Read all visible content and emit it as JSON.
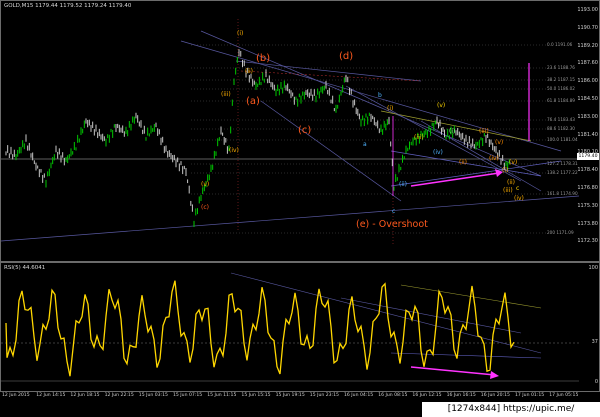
{
  "chart": {
    "title": "GOLD,M15  1179.44 1179.52 1179.24 1179.40",
    "rsi_title": "RSI(5) 44.6041",
    "price_ticks": [
      "1193.00",
      "1190.70",
      "1189.20",
      "1187.60",
      "1186.00",
      "1184.50",
      "1183.00",
      "1181.40",
      "1180.10",
      "1178.40",
      "1176.80",
      "1175.30",
      "1173.80",
      "1172.30"
    ],
    "current_price": "1179.40",
    "rsi_ticks": [
      "100",
      "37",
      "0"
    ],
    "time_ticks": [
      "12 Jun 2015",
      "12 Jun 14:15",
      "12 Jun 18:15",
      "12 Jun 22:15",
      "15 Jun 03:15",
      "15 Jun 07:15",
      "15 Jun 11:15",
      "15 Jun 15:15",
      "15 Jun 19:15",
      "15 Jun 23:15",
      "16 Jun 04:15",
      "16 Jun 08:15",
      "16 Jun 12:15",
      "16 Jun 16:15",
      "16 Jun 20:15",
      "17 Jun 01:15",
      "17 Jun 05:15"
    ],
    "wave_labels": [
      "(a)",
      "(b)",
      "(c)",
      "(d)",
      "(e) - Overshoot"
    ],
    "small_labels": [
      "b",
      "a",
      "c",
      "(i)",
      "(ii)",
      "(iii)",
      "(iv)",
      "(v)",
      "(i)",
      "(ii)",
      "(iii)",
      "(iv)",
      "(v)",
      "(i)",
      "(ii)",
      "(iii)",
      "(iv)",
      "(v)",
      "c",
      "(i)",
      "(ii)",
      "(iii)",
      "(iv)",
      "(v)",
      "(c)"
    ],
    "fib_levels": [
      "0.0  1191.06",
      "23.6  1188.76",
      "38.2  1187.15",
      "50.0  1186.02",
      "61.8  1184.89",
      "76.4  1183.43",
      "88.6  1182.30",
      "100.0  1181.04",
      "127.2  1178.31",
      "138.2  1177.22",
      "161.8  1174.90",
      "200  1171.09"
    ],
    "watermark": "[1274x844] https://upic.me/",
    "colors": {
      "bull": "#00c800",
      "bear": "#c8c8c8",
      "rsi": "#ffd700",
      "arrow": "#ff33ff",
      "wave": "#ff5a1e",
      "channel": "#8080b0"
    }
  }
}
